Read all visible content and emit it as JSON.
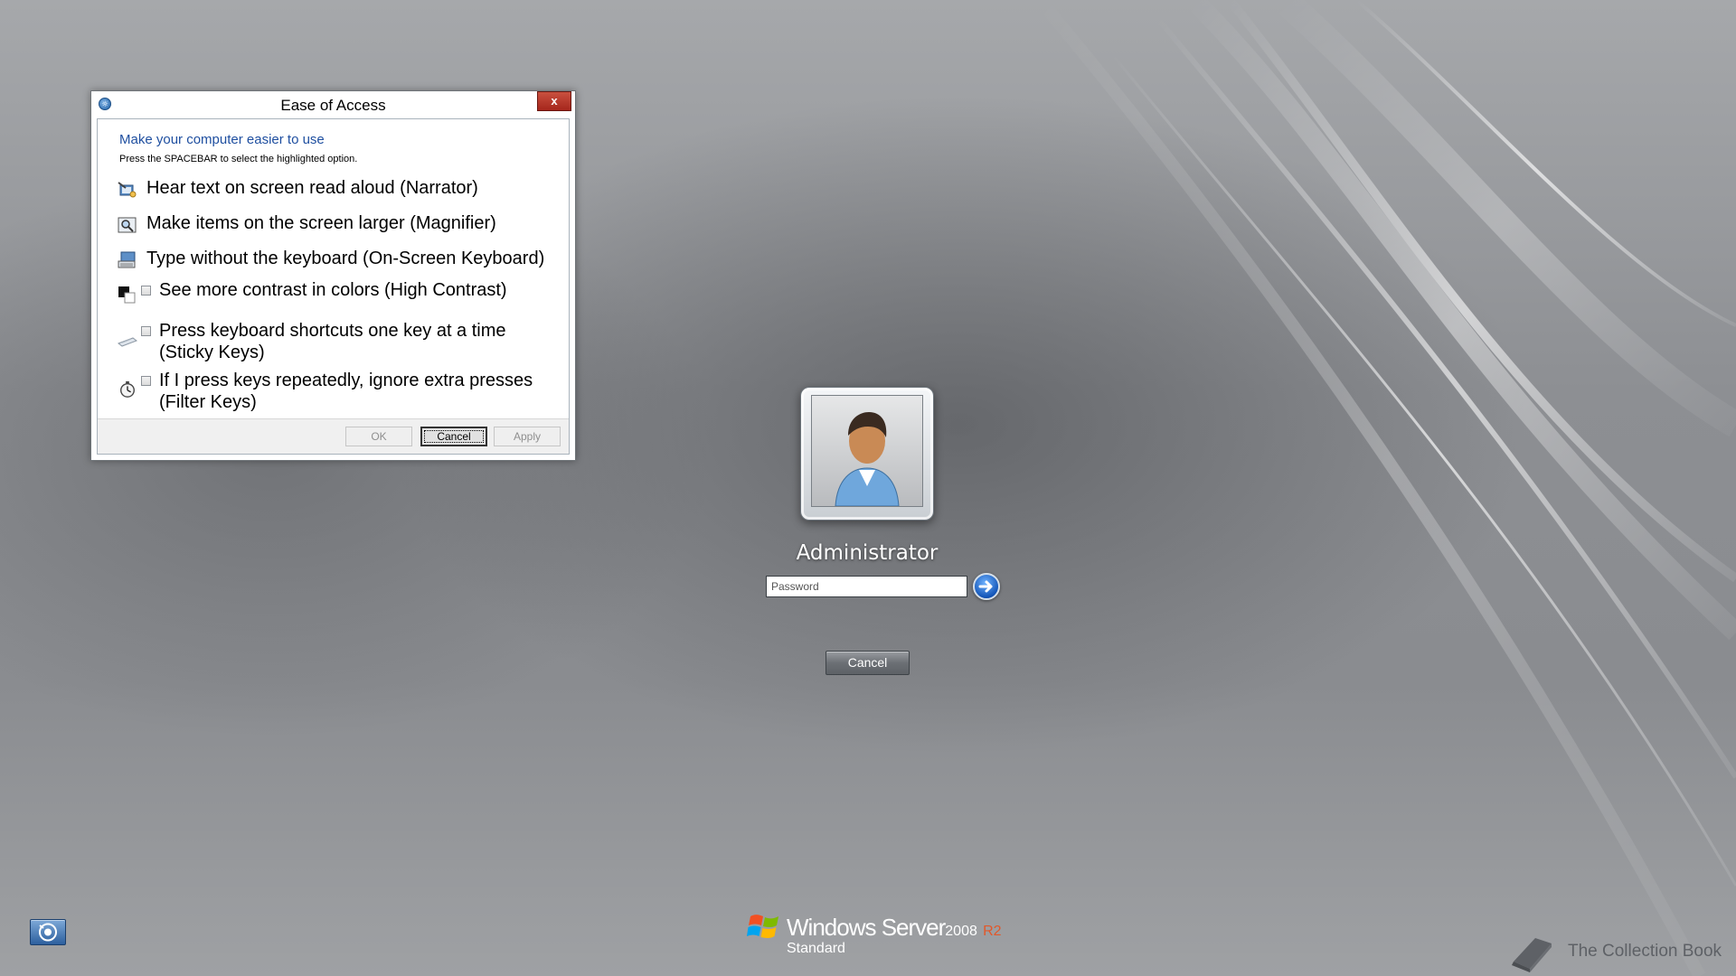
{
  "dialog": {
    "title": "Ease of Access",
    "close_label": "x",
    "heading": "Make your computer easier to use",
    "hint": "Press the SPACEBAR to select the highlighted option.",
    "options": [
      {
        "label": "Hear text on screen read aloud (Narrator)",
        "icon": "narrator-icon"
      },
      {
        "label": "Make items on the screen larger (Magnifier)",
        "icon": "magnifier-icon"
      },
      {
        "label": "Type without the keyboard (On-Screen Keyboard)",
        "icon": "keyboard-icon"
      }
    ],
    "checkbox_options": [
      {
        "label": "See more contrast in colors (High Contrast)",
        "icon": "high-contrast-icon",
        "checked": false
      },
      {
        "label": "Press keyboard shortcuts one key at a time (Sticky Keys)",
        "icon": "sticky-keys-icon",
        "checked": false
      },
      {
        "label": "If I press keys repeatedly, ignore extra presses (Filter Keys)",
        "icon": "filter-keys-icon",
        "checked": false
      }
    ],
    "buttons": {
      "ok": "OK",
      "cancel": "Cancel",
      "apply": "Apply"
    }
  },
  "logon": {
    "username": "Administrator",
    "password_placeholder": "Password",
    "cancel_label": "Cancel"
  },
  "branding": {
    "product": "Windows Server",
    "version": "2008",
    "release": "R2",
    "edition": "Standard"
  },
  "watermark": "The Collection Book",
  "colors": {
    "accent_blue": "#1f4fa0",
    "close_red": "#b8352a",
    "r2_orange": "#e2582a"
  }
}
